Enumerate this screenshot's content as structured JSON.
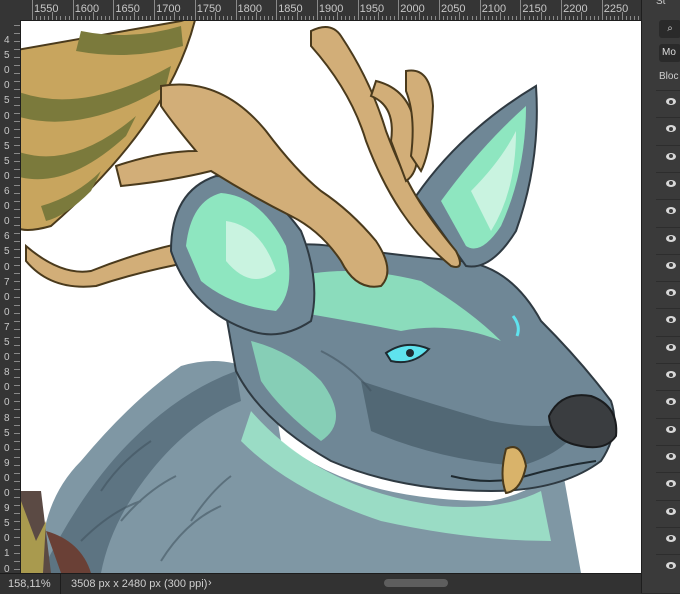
{
  "ruler": {
    "top_labels": [
      "1550",
      "1600",
      "1650",
      "1700",
      "1750",
      "1800",
      "1850",
      "1900",
      "1950",
      "2000",
      "2050",
      "2100",
      "2150",
      "2200",
      "2250"
    ],
    "left_labels": [
      "4",
      "5",
      "0",
      "0",
      "5",
      "0",
      "0",
      "5",
      "5",
      "0",
      "6",
      "0",
      "0",
      "6",
      "5",
      "0",
      "7",
      "0",
      "0",
      "7",
      "5",
      "0",
      "8",
      "0",
      "0",
      "8",
      "5",
      "0",
      "9",
      "0",
      "0",
      "9",
      "5",
      "0",
      "1",
      "0"
    ]
  },
  "status": {
    "zoom": "158,11%",
    "doc_info": "3508 px x 2480 px (300 ppi)",
    "arrow": "›"
  },
  "panel": {
    "title": "St",
    "search_icon": "⌕",
    "mode": "Mo",
    "block_label": "Bloc",
    "layer_count": 18
  },
  "colors": {
    "fur_gray": "#6f8796",
    "fur_dark": "#4e6370",
    "mint": "#8ee6c0",
    "antler": "#d2ae78",
    "eye": "#5fe3ee",
    "nose": "#3a3d40",
    "hat": "#c8a55e",
    "hat_stripe": "#7b7a3c"
  }
}
